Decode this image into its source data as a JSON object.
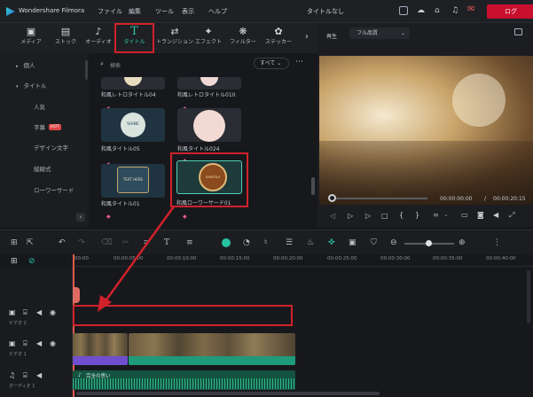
{
  "app": {
    "name": "Wondershare Filmora",
    "doc_title": "タイトルなし",
    "login_label": "ログ"
  },
  "menu": [
    "ファイル",
    "編集",
    "ツール",
    "表示",
    "ヘルプ"
  ],
  "categories": [
    {
      "label": "メディア",
      "icon": "folder-icon"
    },
    {
      "label": "ストック",
      "icon": "stock-icon"
    },
    {
      "label": "オーディオ",
      "icon": "music-icon"
    },
    {
      "label": "タイトル",
      "icon": "title-T-icon"
    },
    {
      "label": "トランジション",
      "icon": "transition-icon"
    },
    {
      "label": "エフェクト",
      "icon": "effect-icon"
    },
    {
      "label": "フィルター",
      "icon": "filter-icon"
    },
    {
      "label": "ステッカー",
      "icon": "sticker-icon"
    }
  ],
  "sidebar": {
    "items": [
      {
        "label": "個人"
      },
      {
        "label": "タイトル"
      },
      {
        "label": "人気"
      },
      {
        "label": "字幕",
        "badge": "HOT"
      },
      {
        "label": "デザイン文字"
      },
      {
        "label": "縦線式"
      },
      {
        "label": "ローワーサード"
      }
    ]
  },
  "search": {
    "placeholder": "検索",
    "filter": "すべて"
  },
  "titles": [
    {
      "label": "和風レトロタイトル04"
    },
    {
      "label": "和風レトロタイトル010"
    },
    {
      "label": "和風タイトル05",
      "text": "SHINE"
    },
    {
      "label": "和風タイトル024"
    },
    {
      "label": "和風タイトル01",
      "text": "TEXT HERE"
    },
    {
      "label": "和風ローワーサード01",
      "text": "SUBTITLE"
    }
  ],
  "preview": {
    "play_label": "再生",
    "quality": "フル品質",
    "current_time": "00:00:00:00",
    "separator": "/",
    "total_time": "00:00:20:15"
  },
  "ruler": [
    "00:00",
    "00:00:05:00",
    "00:00:10:00",
    "00:00:15:00",
    "00:00:20:00",
    "00:00:25:00",
    "00:00:30:00",
    "00:00:35:00",
    "00:00:40:00"
  ],
  "tracks": [
    {
      "label": "ビデオ 2"
    },
    {
      "label": "ビデオ 1"
    },
    {
      "label": "オーディオ 1"
    }
  ],
  "audio_clip": {
    "label": "完全の思い"
  },
  "colors": {
    "accent": "#25c2a0",
    "highlight": "#d0222a",
    "playhead": "#e0574a"
  }
}
